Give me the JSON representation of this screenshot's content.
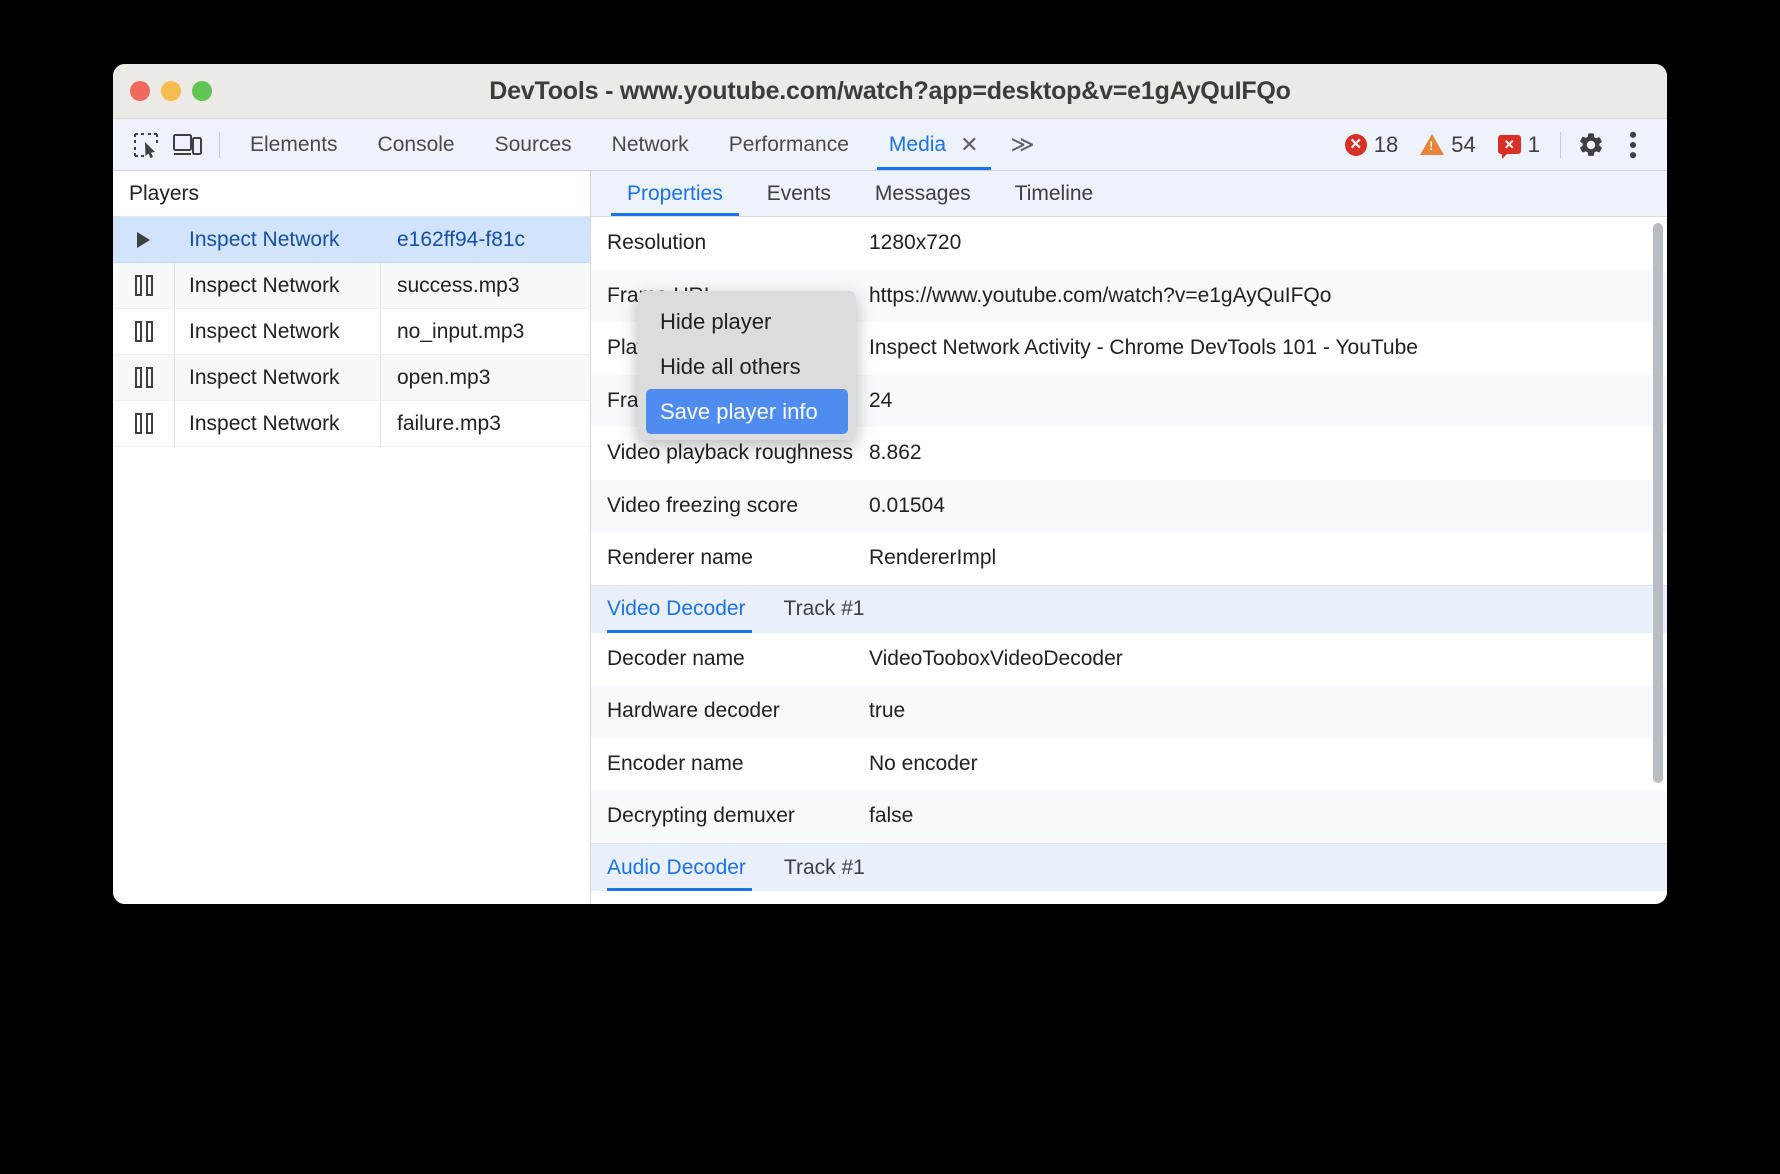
{
  "window": {
    "title": "DevTools - www.youtube.com/watch?app=desktop&v=e1gAyQuIFQo"
  },
  "toolbar": {
    "inspect_icon": "inspect-element-icon",
    "device_icon": "device-toolbar-icon",
    "tabs": [
      {
        "label": "Elements",
        "active": false
      },
      {
        "label": "Console",
        "active": false
      },
      {
        "label": "Sources",
        "active": false
      },
      {
        "label": "Network",
        "active": false
      },
      {
        "label": "Performance",
        "active": false
      },
      {
        "label": "Media",
        "active": true
      }
    ],
    "close_tab_label": "✕",
    "overflow_label": "≫",
    "badges": {
      "errors": "18",
      "warnings": "54",
      "issues": "1"
    },
    "settings_icon": "gear-icon",
    "more_icon": "kebab-menu-icon",
    "accent_color": "#1a73e8",
    "error_color": "#d93025",
    "warning_color": "#e8833a"
  },
  "players_panel": {
    "header": "Players",
    "rows": [
      {
        "state_icon": "play-icon",
        "inspect": "Inspect Network",
        "name": "e162ff94-f81c",
        "selected": true
      },
      {
        "state_icon": "pause-icon",
        "inspect": "Inspect Network",
        "name": "success.mp3",
        "selected": false
      },
      {
        "state_icon": "pause-icon",
        "inspect": "Inspect Network",
        "name": "no_input.mp3",
        "selected": false
      },
      {
        "state_icon": "pause-icon",
        "inspect": "Inspect Network",
        "name": "open.mp3",
        "selected": false
      },
      {
        "state_icon": "pause-icon",
        "inspect": "Inspect Network",
        "name": "failure.mp3",
        "selected": false
      }
    ]
  },
  "context_menu": {
    "items": [
      {
        "label": "Hide player",
        "highlighted": false
      },
      {
        "label": "Hide all others",
        "highlighted": false
      },
      {
        "label": "Save player info",
        "highlighted": true
      }
    ]
  },
  "details_panel": {
    "tabs": [
      {
        "label": "Properties",
        "active": true
      },
      {
        "label": "Events",
        "active": false
      },
      {
        "label": "Messages",
        "active": false
      },
      {
        "label": "Timeline",
        "active": false
      }
    ],
    "properties": [
      {
        "key": "Resolution",
        "value": "1280x720"
      },
      {
        "key": "Frame URL",
        "value": "https://www.youtube.com/watch?v=e1gAyQuIFQo"
      },
      {
        "key": "Playback frame title",
        "value": "Inspect Network Activity - Chrome DevTools 101 - YouTube"
      },
      {
        "key": "Frame rate",
        "value": "24"
      },
      {
        "key": "Video playback roughness",
        "value": "8.862"
      },
      {
        "key": "Video freezing score",
        "value": "0.01504"
      },
      {
        "key": "Renderer name",
        "value": "RendererImpl"
      }
    ],
    "video_decoder_section": {
      "tabs": [
        {
          "label": "Video Decoder",
          "active": true
        },
        {
          "label": "Track #1",
          "active": false
        }
      ],
      "properties": [
        {
          "key": "Decoder name",
          "value": "VideoTooboxVideoDecoder"
        },
        {
          "key": "Hardware decoder",
          "value": "true"
        },
        {
          "key": "Encoder name",
          "value": "No encoder"
        },
        {
          "key": "Decrypting demuxer",
          "value": "false"
        }
      ]
    },
    "audio_decoder_section": {
      "tabs": [
        {
          "label": "Audio Decoder",
          "active": true
        },
        {
          "label": "Track #1",
          "active": false
        }
      ]
    }
  }
}
